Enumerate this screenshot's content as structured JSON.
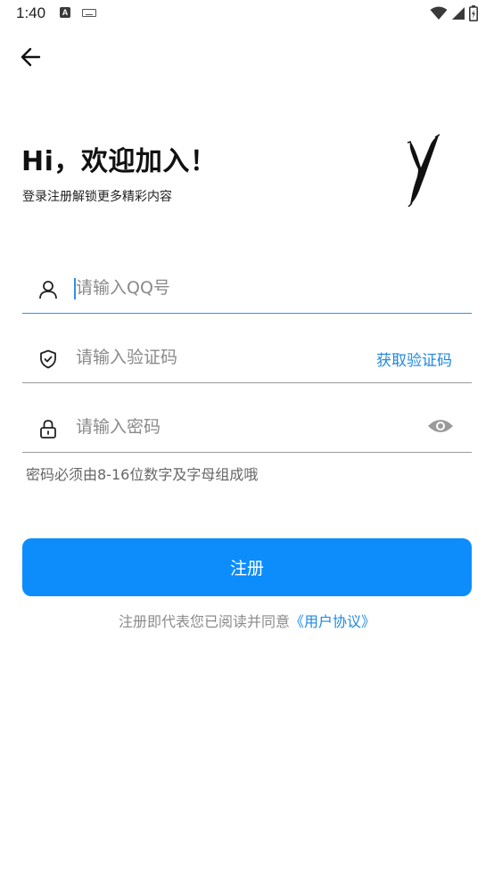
{
  "status_bar": {
    "time": "1:40",
    "notif_a": "A"
  },
  "header": {
    "title": "Hi，欢迎加入！",
    "subtitle": "登录注册解锁更多精彩内容"
  },
  "form": {
    "qq_placeholder": "请输入QQ号",
    "code_placeholder": "请输入验证码",
    "get_code_label": "获取验证码",
    "password_placeholder": "请输入密码",
    "password_hint": "密码必须由8-16位数字及字母组成哦"
  },
  "actions": {
    "register_label": "注册"
  },
  "agreement": {
    "prefix": "注册即代表您已阅读并同意",
    "link": "《用户协议》"
  },
  "colors": {
    "accent": "#0d8dfb",
    "link": "#1e88e5",
    "active_underline": "#2f8fe6"
  },
  "icons": [
    "back-arrow-icon",
    "user-icon",
    "shield-check-icon",
    "lock-icon",
    "eye-icon",
    "wifi-icon",
    "signal-icon",
    "battery-icon"
  ]
}
